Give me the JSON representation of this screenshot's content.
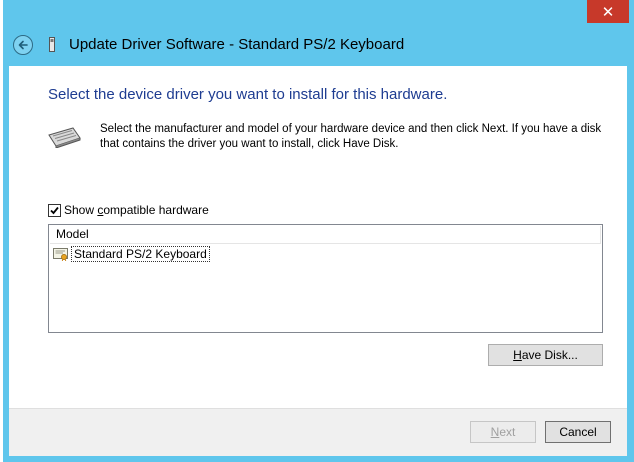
{
  "window": {
    "title": "Update Driver Software - Standard PS/2 Keyboard",
    "close_glyph": "✕"
  },
  "content": {
    "heading": "Select the device driver you want to install for this hardware.",
    "instructions": "Select the manufacturer and model of your hardware device and then click Next. If you have a disk that contains the driver you want to install, click Have Disk.",
    "show_compatible": {
      "label_prefix": "Show ",
      "label_accel": "c",
      "label_suffix": "ompatible hardware",
      "checked": true
    },
    "model_list": {
      "column_header": "Model",
      "items": [
        {
          "label": "Standard PS/2 Keyboard",
          "icon": "driver-certificate-icon",
          "selected": true
        }
      ]
    },
    "have_disk": {
      "accel": "H",
      "rest": "ave Disk..."
    }
  },
  "footer": {
    "next": {
      "accel": "N",
      "rest": "ext",
      "enabled": false
    },
    "cancel": {
      "label": "Cancel"
    }
  },
  "colors": {
    "title_bar": "#5fc6ec",
    "close_button": "#c7392a",
    "heading_text": "#1e3c91"
  }
}
